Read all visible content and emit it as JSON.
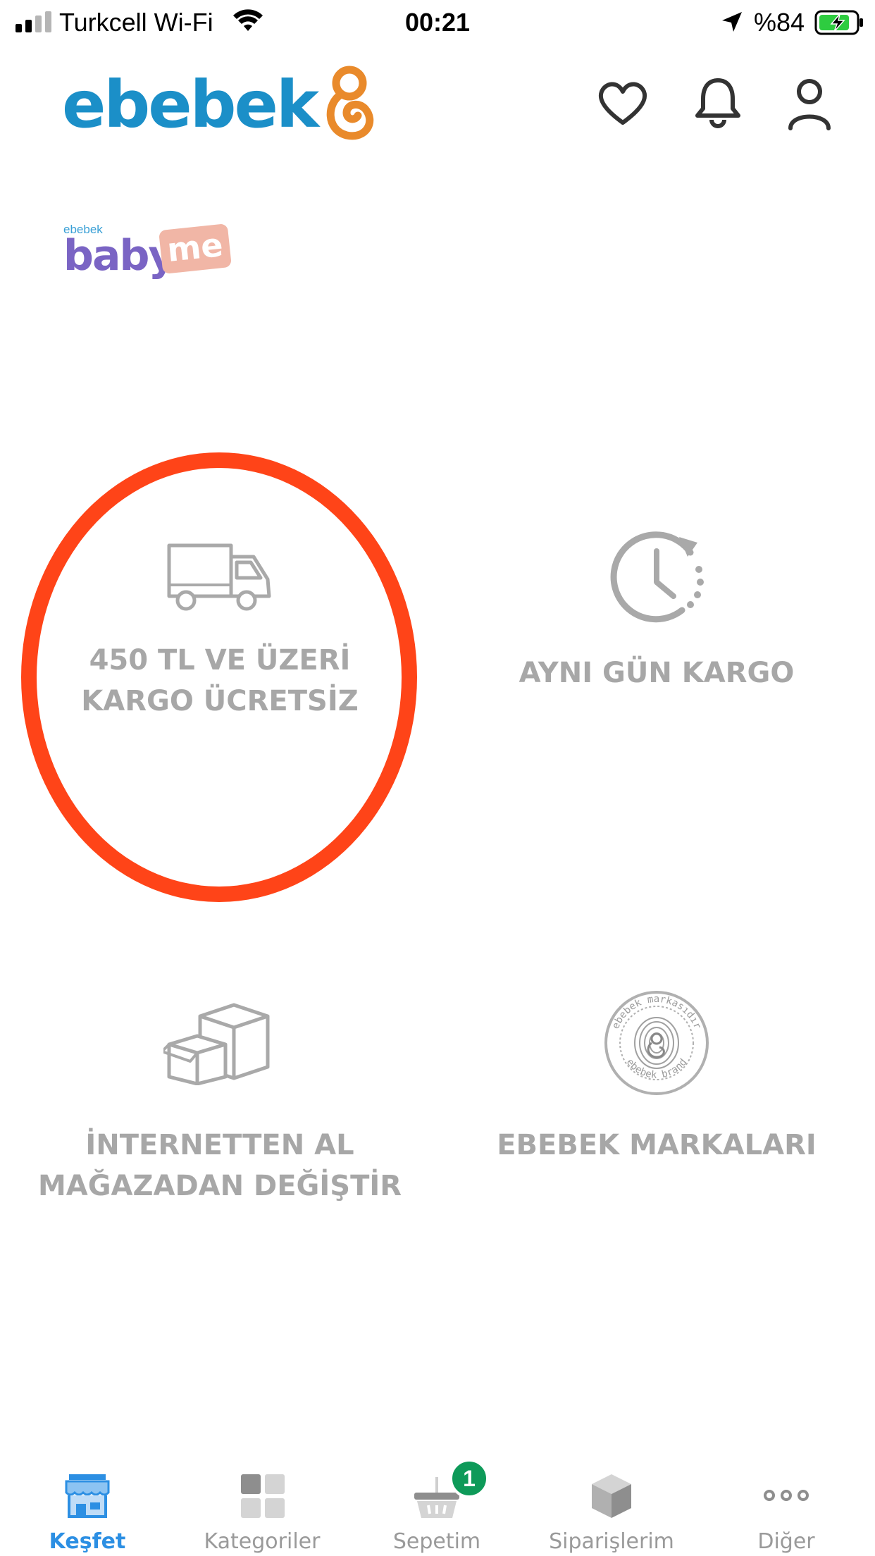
{
  "status_bar": {
    "carrier": "Turkcell Wi-Fi",
    "time": "00:21",
    "battery": "%84",
    "icons": [
      "signal-icon",
      "wifi-icon",
      "location-arrow-icon",
      "battery-charging-icon"
    ]
  },
  "header": {
    "logo_text": "ebebek",
    "icons": [
      "heart-icon",
      "bell-icon",
      "user-icon"
    ]
  },
  "babyme": {
    "small": "ebebek",
    "baby": "baby",
    "me": "me"
  },
  "features": [
    {
      "icon": "truck-icon",
      "label": "450 TL VE ÜZERİ\nKARGO ÜCRETSİZ",
      "highlighted": true
    },
    {
      "icon": "clock-icon",
      "label": "AYNI GÜN KARGO"
    },
    {
      "icon": "boxes-icon",
      "label": "İNTERNETTEN AL\nMAĞAZADAN DEĞİŞTİR"
    },
    {
      "icon": "brand-stamp-icon",
      "label": "EBEBEK MARKALARI",
      "stamp_top": "ebebek markasıdır",
      "stamp_bottom": "ebebek brand"
    }
  ],
  "highlight_color": "#ff4418",
  "accent_color": "#2c8fe3",
  "bottom_nav": {
    "items": [
      {
        "label": "Keşfet",
        "icon": "store-icon",
        "active": true
      },
      {
        "label": "Kategoriler",
        "icon": "grid-icon"
      },
      {
        "label": "Sepetim",
        "icon": "basket-icon",
        "badge": "1"
      },
      {
        "label": "Siparişlerim",
        "icon": "package-icon"
      },
      {
        "label": "Diğer",
        "icon": "more-dots-icon"
      }
    ]
  }
}
